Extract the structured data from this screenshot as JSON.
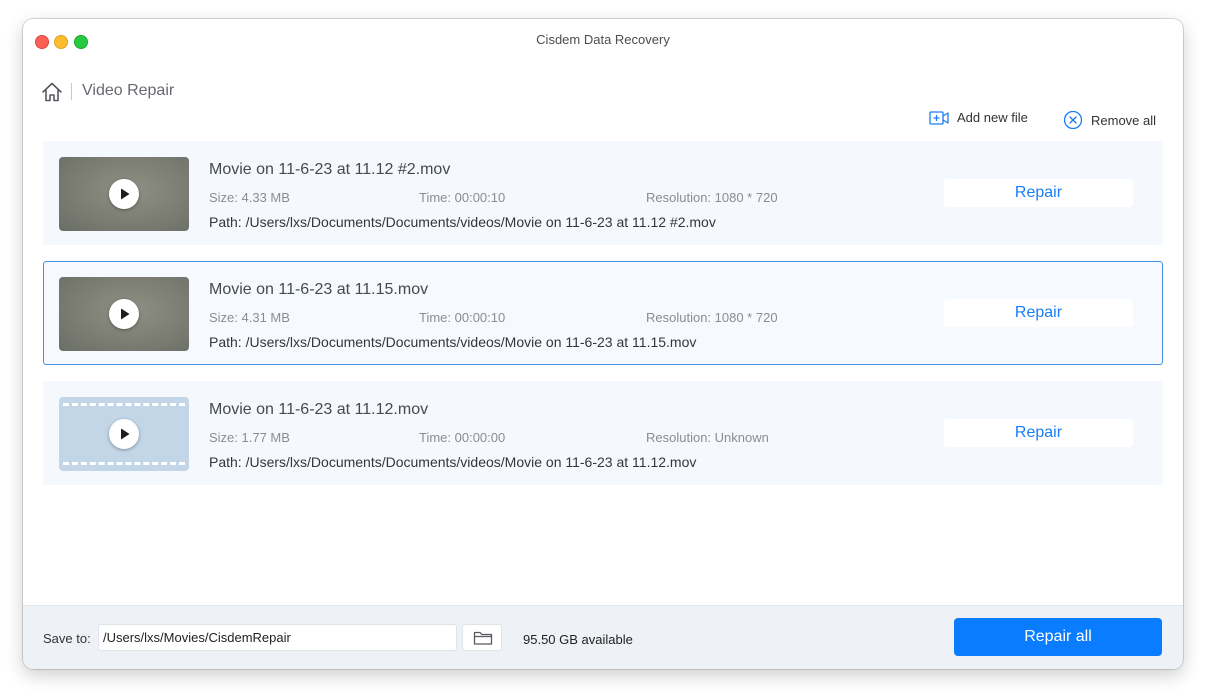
{
  "window": {
    "title": "Cisdem Data Recovery"
  },
  "breadcrumb": {
    "home_icon": "home-icon",
    "title": "Video Repair"
  },
  "toolbar": {
    "add_file_label": "Add new file",
    "add_file_icon": "add-video-icon",
    "remove_all_label": "Remove all",
    "remove_all_icon": "circle-x-icon"
  },
  "files": [
    {
      "name": "Movie on 11-6-23 at 11.12 #2.mov",
      "size": "Size: 4.33 MB",
      "time": "Time: 00:00:10",
      "resolution": "Resolution: 1080 * 720",
      "path": "Path: /Users/lxs/Documents/Documents/videos/Movie on 11-6-23 at 11.12 #2.mov",
      "repair_label": "Repair"
    },
    {
      "name": "Movie on 11-6-23 at 11.15.mov",
      "size": "Size: 4.31 MB",
      "time": "Time: 00:00:10",
      "resolution": "Resolution: 1080 * 720",
      "path": "Path: /Users/lxs/Documents/Documents/videos/Movie on 11-6-23 at 11.15.mov",
      "repair_label": "Repair"
    },
    {
      "name": "Movie on 11-6-23 at 11.12.mov",
      "size": "Size: 1.77 MB",
      "time": "Time: 00:00:00",
      "resolution": "Resolution: Unknown",
      "path": "Path: /Users/lxs/Documents/Documents/videos/Movie on 11-6-23 at 11.12.mov",
      "repair_label": "Repair"
    }
  ],
  "footer": {
    "save_label": "Save to:",
    "save_path": "/Users/lxs/Movies/CisdemRepair",
    "folder_icon": "folder-icon",
    "available": "95.50 GB available",
    "repair_all_label": "Repair all"
  },
  "colors": {
    "accent": "#0a7cff",
    "link": "#1a7ef2",
    "selected_border": "#4a90e2",
    "card_bg": "#f5f8fd",
    "footer_bg": "#eef1f6"
  }
}
